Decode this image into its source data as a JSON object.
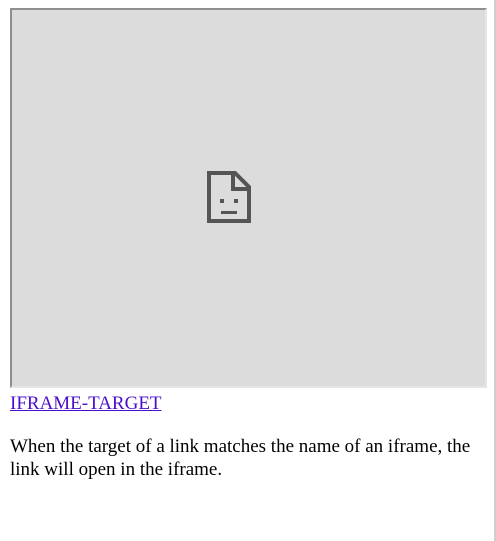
{
  "iframe": {
    "state": "failed-to-load",
    "icon": "sad-page-icon",
    "background_color": "#dcdcdc"
  },
  "link": {
    "text": "IFRAME-TARGET",
    "color": "#4b0ecc"
  },
  "description": {
    "text": "When the target of a link matches the name of an iframe, the link will open in the iframe."
  }
}
